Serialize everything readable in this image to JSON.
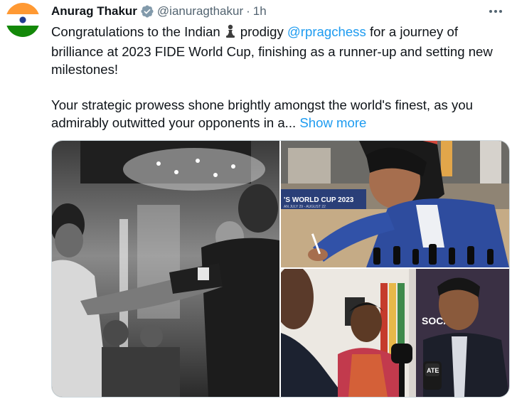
{
  "tweet": {
    "author_name": "Anurag Thakur",
    "handle": "@ianuragthakur",
    "separator": "·",
    "time": "1h",
    "text_part1": "Congratulations to the Indian",
    "text_part2": "prodigy",
    "mention": "@rpragchess",
    "text_part3": "for a journey of brilliance at 2023 FIDE World Cup, finishing as a runner-up and setting new milestones!",
    "text_para2": "Your strategic prowess shone brightly amongst the world's finest, as you admirably outwitted your opponents in a...",
    "show_more": "Show more"
  },
  "media": {
    "photo2_banner": "'S WORLD CUP 2023",
    "photo2_banner_sub": "AN JULY 29 - AUGUST 22",
    "photo3_brand": "SOCAR",
    "photo3_mic_logo": "ATE"
  },
  "icons": {
    "avatar": "india-flag-avatar",
    "verified": "verified-badge-icon",
    "more": "more-options-icon",
    "emoji": "chess-pawn-icon"
  },
  "colors": {
    "accent": "#1d9bf0",
    "secondary_text": "#536471",
    "primary_text": "#0f1419"
  }
}
